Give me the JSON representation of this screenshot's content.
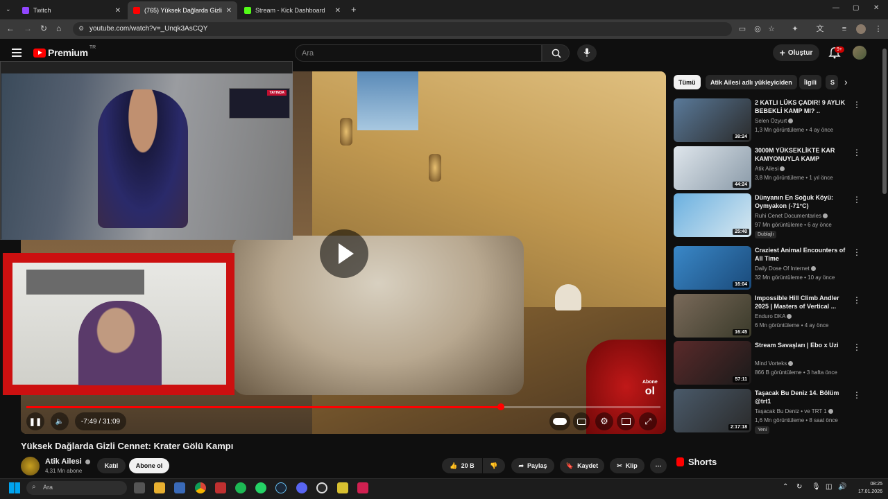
{
  "browser": {
    "tabs": [
      {
        "label": "Twitch",
        "icon": "twitch-icon",
        "color": "#9146ff"
      },
      {
        "label": "(765) Yüksek Dağlarda Gizli",
        "icon": "youtube-icon",
        "color": "#ff0000"
      },
      {
        "label": "Stream - Kick Dashboard",
        "icon": "kick-icon",
        "color": "#53fc18"
      }
    ],
    "url": "youtube.com/watch?v=_Unqk3AsCQY"
  },
  "header": {
    "logo_word": "Premium",
    "logo_region": "TR",
    "search_placeholder": "Ara",
    "create_label": "Oluştur",
    "notification_count": "9+"
  },
  "player": {
    "time": "-7:49 / 31:09",
    "progress_fraction": 0.748,
    "overlay_label_top": "Abone",
    "overlay_label_bottom": "ol",
    "yayinda_badge": "YAYINDA"
  },
  "video": {
    "title": "Yüksek Dağlarda Gizli Cennet: Krater Gölü Kampı",
    "channel": "Atik Ailesi",
    "subscribers": "4,31 Mn abone",
    "join_label": "Katıl",
    "subscribe_label": "Abone ol",
    "likes": "20 B",
    "share_label": "Paylaş",
    "save_label": "Kaydet",
    "clip_label": "Klip"
  },
  "sidebar": {
    "chips": [
      "Tümü",
      "Atik Ailesi adlı yükleyiciden",
      "İlgili",
      "S"
    ],
    "recommendations": [
      {
        "title": "2 KATLI LÜKS ÇADIR! 9 AYLIK BEBEKLİ KAMP MI? ..",
        "channel": "Selen Özyurt",
        "meta": "1,3 Mn görüntüleme • 4 ay önce",
        "duration": "38:24",
        "colors": [
          "#5a7a9a",
          "#2a2a2a"
        ]
      },
      {
        "title": "3000M YÜKSEKLİKTE KAR KAMYONUYLA KAMP",
        "channel": "Atik Ailesi",
        "meta": "3,8 Mn görüntüleme • 1 yıl önce",
        "duration": "44:24",
        "colors": [
          "#dfe6ec",
          "#8a9aa8"
        ]
      },
      {
        "title": "Dünyanın En Soğuk Köyü: Oymyakon (-71°C)",
        "channel": "Ruhi Cenet Documentaries",
        "meta": "97 Mn görüntüleme • 6 ay önce",
        "duration": "25:40",
        "tag": "Dublajlı",
        "colors": [
          "#6ab0e0",
          "#d8e8f0"
        ]
      },
      {
        "title": "Craziest Animal Encounters of All Time",
        "channel": "Daily Dose Of Internet",
        "meta": "32 Mn görüntüleme • 10 ay önce",
        "duration": "16:04",
        "colors": [
          "#3a88c8",
          "#1a4a7a"
        ]
      },
      {
        "title": "Impossible Hill Climb Andler 2025 | Masters of Vertical ...",
        "channel": "Enduro DKA",
        "meta": "6 Mn görüntüleme • 4 ay önce",
        "duration": "16:45",
        "colors": [
          "#7a6a5a",
          "#3a3a2a"
        ]
      },
      {
        "title": "Stream Savaşları | Ebo x Uzi",
        "channel": "Mind Vorteks",
        "meta": "866 B görüntüleme • 3 hafta önce",
        "duration": "57:11",
        "colors": [
          "#5a2a2a",
          "#1a1a1a"
        ]
      },
      {
        "title": "Taşacak Bu Deniz 14. Bölüm @trt1",
        "channel": "Taşacak Bu Deniz • ve TRT 1",
        "meta": "1,6 Mn görüntüleme • 8 saat önce",
        "duration": "2:17:18",
        "tag": "Yeni",
        "colors": [
          "#4a5a6a",
          "#2a2a2a"
        ]
      }
    ],
    "shorts_label": "Shorts"
  },
  "taskbar": {
    "search_placeholder": "Ara",
    "time": "08:25",
    "date": "17.01.2026"
  }
}
